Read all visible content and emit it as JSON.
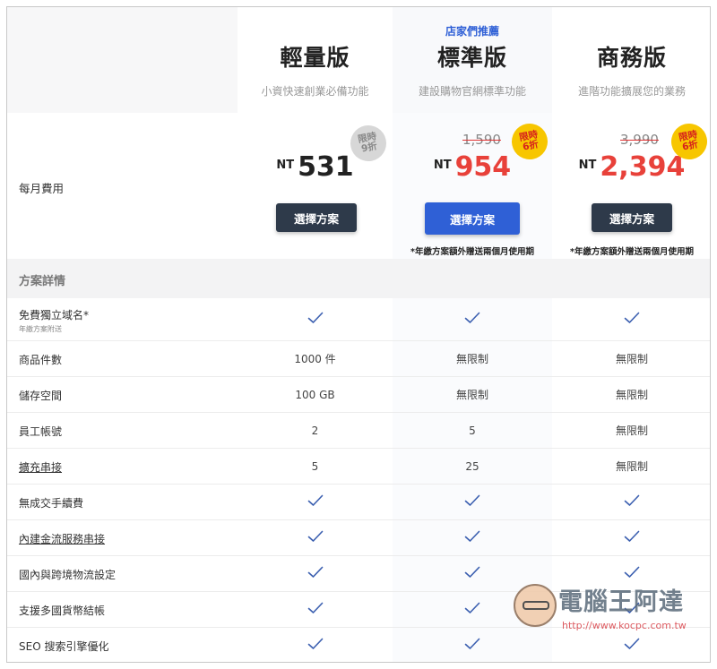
{
  "plans": [
    {
      "name": "輕量版",
      "desc": "小資快速創業必備功能",
      "price": "531",
      "currency": "NT",
      "badge": [
        "限時",
        "9折"
      ],
      "button": "選擇方案"
    },
    {
      "name": "標準版",
      "desc": "建設購物官網標準功能",
      "recommend": "店家們推薦",
      "old_price": "1,590",
      "price": "954",
      "currency": "NT",
      "badge": [
        "限時",
        "6折"
      ],
      "button": "選擇方案",
      "note": "*年繳方案額外贈送兩個月使用期"
    },
    {
      "name": "商務版",
      "desc": "進階功能擴展您的業務",
      "old_price": "3,990",
      "price": "2,394",
      "currency": "NT",
      "badge": [
        "限時",
        "6折"
      ],
      "button": "選擇方案",
      "note": "*年繳方案額外贈送兩個月使用期"
    }
  ],
  "price_row_label": "每月費用",
  "section_title": "方案詳情",
  "features": [
    {
      "label": "免費獨立域名*",
      "sub": "年繳方案附送",
      "link": false,
      "values": [
        "check",
        "check",
        "check"
      ]
    },
    {
      "label": "商品件數",
      "link": false,
      "values": [
        "1000 件",
        "無限制",
        "無限制"
      ]
    },
    {
      "label": "儲存空間",
      "link": false,
      "values": [
        "100 GB",
        "無限制",
        "無限制"
      ]
    },
    {
      "label": "員工帳號",
      "link": false,
      "values": [
        "2",
        "5",
        "無限制"
      ]
    },
    {
      "label": "擴充串接",
      "link": true,
      "values": [
        "5",
        "25",
        "無限制"
      ]
    },
    {
      "label": "無成交手續費",
      "link": false,
      "values": [
        "check",
        "check",
        "check"
      ]
    },
    {
      "label": "內建金流服務串接",
      "link": true,
      "values": [
        "check",
        "check",
        "check"
      ]
    },
    {
      "label": "國內與跨境物流設定",
      "link": false,
      "values": [
        "check",
        "check",
        "check"
      ]
    },
    {
      "label": "支援多國貨幣結帳",
      "link": false,
      "values": [
        "check",
        "check",
        "check"
      ]
    },
    {
      "label": "SEO 搜索引擎優化",
      "link": false,
      "values": [
        "check",
        "check",
        "check"
      ]
    }
  ],
  "watermark": {
    "title": "電腦王阿達",
    "url": "http://www.kocpc.com.tw"
  },
  "colors": {
    "accent_blue": "#2f60d6",
    "dark_button": "#2e3a4a",
    "price_red": "#e8413a",
    "check": "#3b5fb0"
  }
}
